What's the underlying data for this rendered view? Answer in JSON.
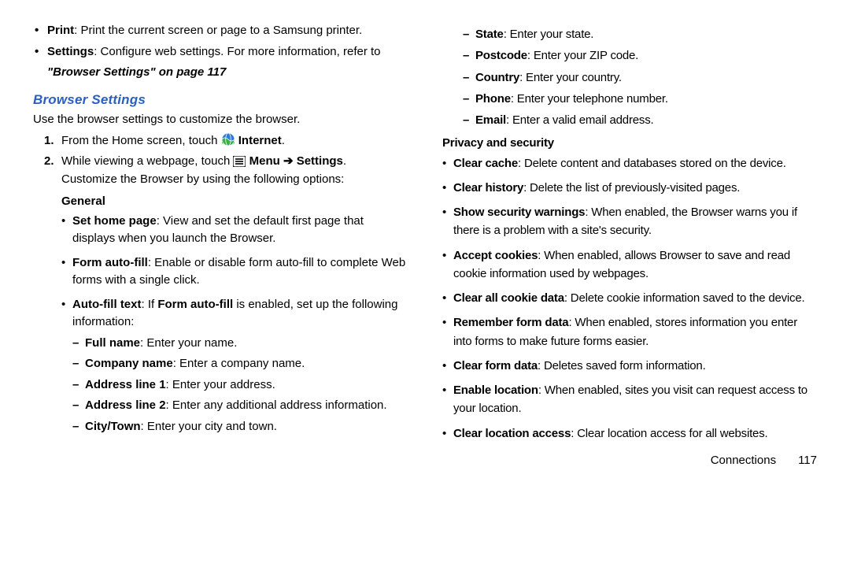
{
  "footer": {
    "section": "Connections",
    "page": "117"
  },
  "left": {
    "bullets": [
      {
        "term": "Print",
        "rest": ": Print the current screen or page to a Samsung printer."
      },
      {
        "term": "Settings",
        "rest": ": Configure web settings. For more information, refer to "
      }
    ],
    "xref": "\"Browser Settings\" on page 117",
    "heading": "Browser Settings",
    "intro": "Use the browser settings to customize the browser.",
    "step1_pre": "From the Home screen, touch ",
    "step1_post": " Internet",
    "step1_period": ".",
    "step2_pre": "While viewing a webpage, touch ",
    "step2_menu": " Menu ",
    "step2_settings": " Settings",
    "step2_period": ".",
    "step2_line2": "Customize the Browser by using the following options:",
    "general_head": "General",
    "general": [
      {
        "term": "Set home page",
        "rest": ": View and set the default first page that displays when you launch the Browser."
      },
      {
        "term": "Form auto-fill",
        "rest": ": Enable or disable form auto-fill to complete Web forms with a single click."
      }
    ],
    "autofill_term": "Auto-fill text",
    "autofill_mid": ": If ",
    "autofill_bold2": "Form auto-fill",
    "autofill_rest": " is enabled, set up the following information:",
    "autofill_fields": [
      {
        "term": "Full name",
        "rest": ": Enter your name."
      },
      {
        "term": "Company name",
        "rest": ": Enter a company name."
      },
      {
        "term": "Address line 1",
        "rest": ": Enter your address."
      },
      {
        "term": "Address line 2",
        "rest": ": Enter any additional address information."
      },
      {
        "term": "City/Town",
        "rest": ": Enter your city and town."
      }
    ]
  },
  "right": {
    "autofill_cont": [
      {
        "term": "State",
        "rest": ": Enter your state."
      },
      {
        "term": "Postcode",
        "rest": ": Enter your ZIP code."
      },
      {
        "term": "Country",
        "rest": ": Enter your country."
      },
      {
        "term": "Phone",
        "rest": ": Enter your telephone number."
      },
      {
        "term": "Email",
        "rest": ": Enter a valid email address."
      }
    ],
    "privsec_head": "Privacy and security",
    "privsec": [
      {
        "term": "Clear cache",
        "rest": ": Delete content and databases stored on the device."
      },
      {
        "term": "Clear history",
        "rest": ": Delete the list of previously-visited pages."
      },
      {
        "term": "Show security warnings",
        "rest": ": When enabled, the Browser warns you if there is a problem with a site's security."
      },
      {
        "term": "Accept cookies",
        "rest": ": When enabled, allows Browser to save and read cookie information used by webpages."
      },
      {
        "term": "Clear all cookie data",
        "rest": ": Delete cookie information saved to the device."
      },
      {
        "term": "Remember form data",
        "rest": ": When enabled, stores information you enter into forms to make future forms easier."
      },
      {
        "term": "Clear form data",
        "rest": ": Deletes saved form information."
      },
      {
        "term": "Enable location",
        "rest": ": When enabled, sites you visit can request access to your location."
      },
      {
        "term": "Clear location access",
        "rest": ": Clear location access for all websites."
      }
    ]
  }
}
